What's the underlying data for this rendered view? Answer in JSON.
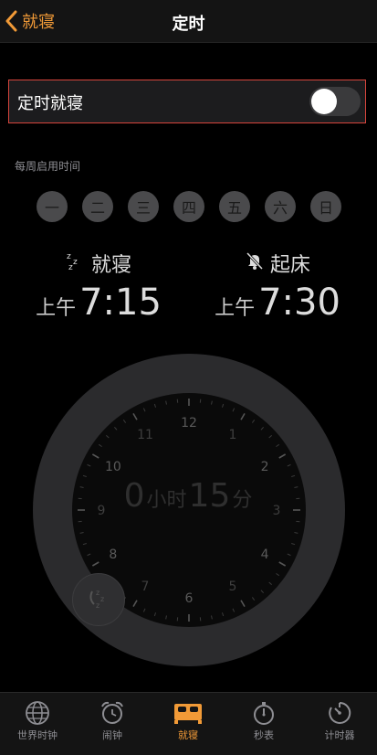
{
  "nav": {
    "back_label": "就寝",
    "title": "定时"
  },
  "schedule_toggle": {
    "label": "定时就寝",
    "on": false
  },
  "section_header": "每周启用时间",
  "days": [
    "一",
    "二",
    "三",
    "四",
    "五",
    "六",
    "日"
  ],
  "bedtime": {
    "label": "就寝",
    "ampm": "上午",
    "time": "7:15",
    "icon": "zzz-icon"
  },
  "wake": {
    "label": "起床",
    "ampm": "上午",
    "time": "7:30",
    "icon": "bell-off-icon"
  },
  "clock_numbers": [
    "12",
    "2",
    "4",
    "6",
    "8",
    "10"
  ],
  "clock_minor_numbers": [
    "1",
    "3",
    "5",
    "7",
    "9",
    "11"
  ],
  "duration": {
    "hours": "0",
    "hours_unit": "小时",
    "minutes": "15",
    "minutes_unit": "分"
  },
  "colors": {
    "accent": "#f19a37",
    "highlight_border": "#d8453c"
  },
  "tabs": [
    {
      "label": "世界时钟",
      "icon": "globe-icon",
      "active": false
    },
    {
      "label": "闹钟",
      "icon": "alarm-clock-icon",
      "active": false
    },
    {
      "label": "就寝",
      "icon": "bed-icon",
      "active": true
    },
    {
      "label": "秒表",
      "icon": "stopwatch-icon",
      "active": false
    },
    {
      "label": "计时器",
      "icon": "timer-icon",
      "active": false
    }
  ]
}
